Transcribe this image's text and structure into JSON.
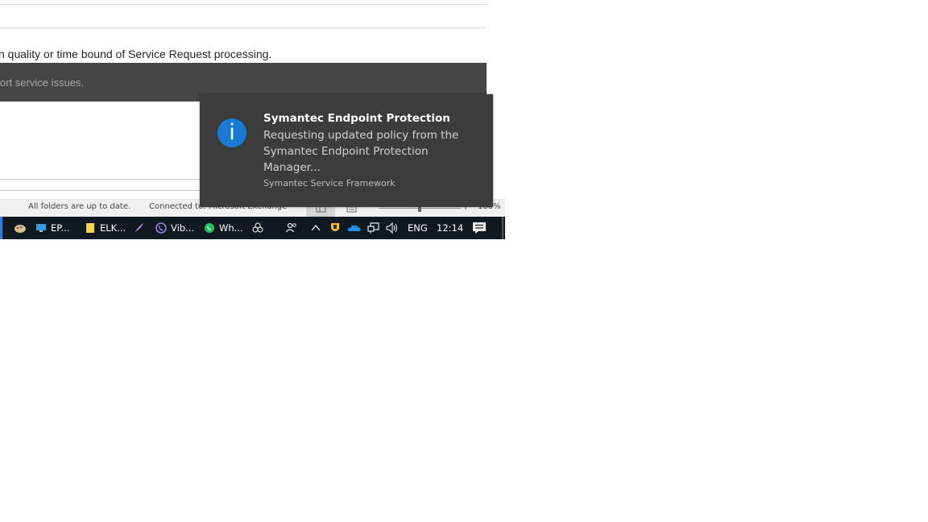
{
  "email": {
    "body_line": "n quality or time bound of Service Request processing.",
    "banner_text": "ort service issues."
  },
  "status_bar": {
    "sync_status": "All folders are up to date.",
    "connection_status": "Connected to: Microsoft Exchange",
    "zoom_level": "100%"
  },
  "taskbar": {
    "items": [
      {
        "label": "EP...",
        "icon": "remote-desktop-icon"
      },
      {
        "label": "ELK...",
        "icon": "sticky-notes-icon"
      },
      {
        "label": "Vib...",
        "icon": "viber-icon"
      },
      {
        "label": "Wh...",
        "icon": "whatsapp-icon"
      }
    ],
    "language": "ENG",
    "clock": "12:14"
  },
  "notification": {
    "title": "Symantec Endpoint Protection",
    "message": "Requesting updated policy from the Symantec Endpoint Protection Manager...",
    "source": "Symantec Service Framework",
    "icon": "info-icon",
    "accent_color": "#1a7ad4"
  }
}
